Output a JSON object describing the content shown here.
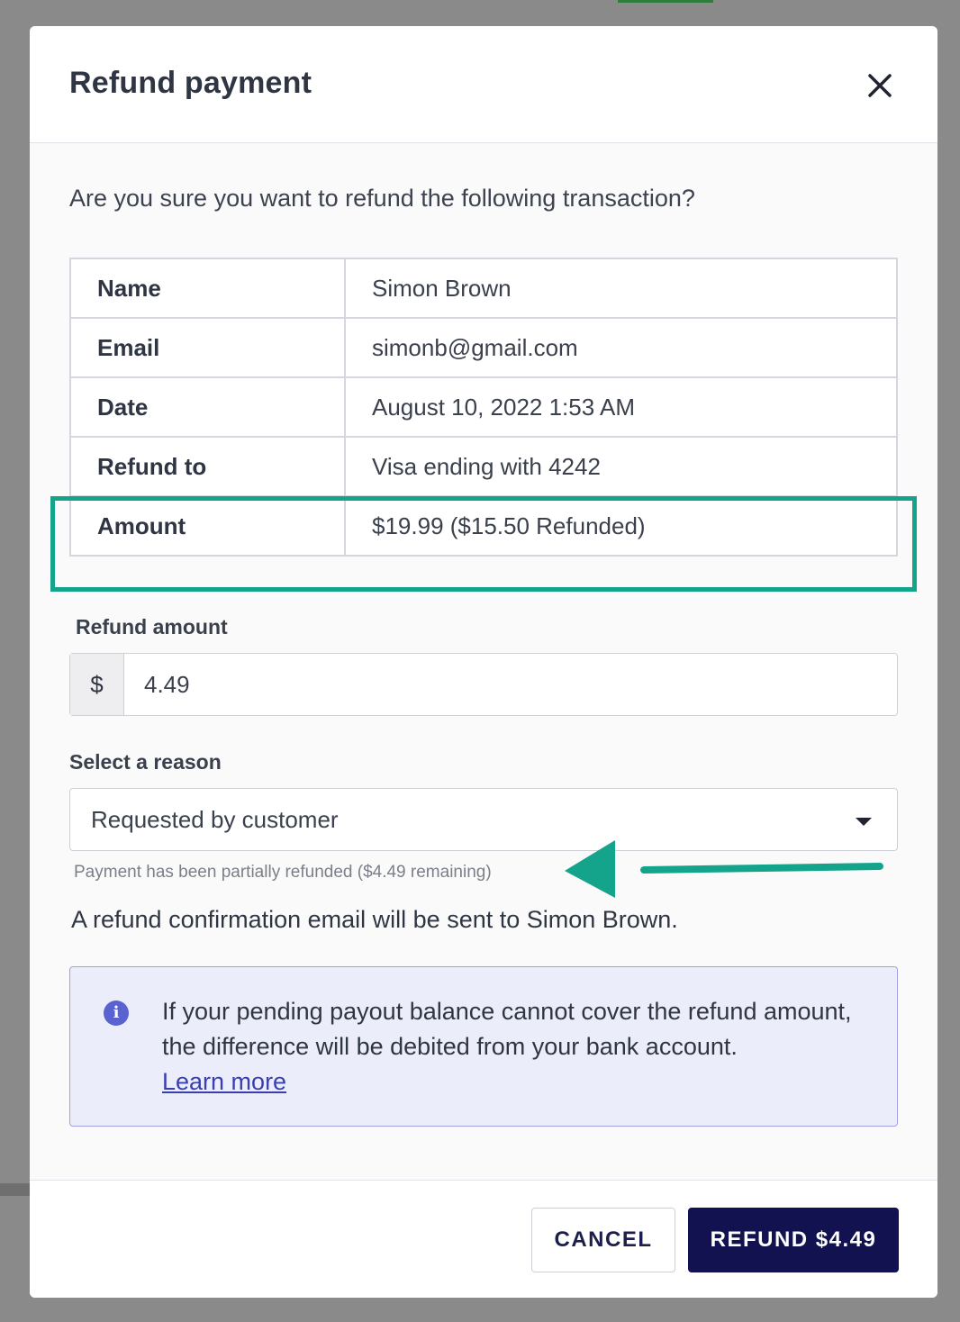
{
  "modal": {
    "title": "Refund payment",
    "question": "Are you sure you want to refund the following transaction?"
  },
  "details": [
    {
      "label": "Name",
      "value": "Simon Brown"
    },
    {
      "label": "Email",
      "value": "simonb@gmail.com"
    },
    {
      "label": "Date",
      "value": "August 10, 2022 1:53 AM"
    },
    {
      "label": "Refund to",
      "value": "Visa ending with 4242"
    },
    {
      "label": "Amount",
      "value": "$19.99 ($15.50 Refunded)"
    }
  ],
  "refund_amount": {
    "label": "Refund amount",
    "currency": "$",
    "value": "4.49"
  },
  "reason": {
    "label": "Select a reason",
    "selected": "Requested by customer",
    "helper": "Payment has been partially refunded ($4.49 remaining)"
  },
  "confirmation": "A refund confirmation email will be sent to Simon Brown.",
  "info": {
    "message": "If your pending payout balance cannot cover the refund amount, the difference will be debited from your bank account.",
    "link": "Learn more",
    "icon": "info-icon"
  },
  "footer": {
    "cancel_label": "CANCEL",
    "refund_label": "REFUND $4.49"
  },
  "colors": {
    "primary": "#121250",
    "highlight": "#14a38b",
    "info_bg": "#ecedfb"
  }
}
